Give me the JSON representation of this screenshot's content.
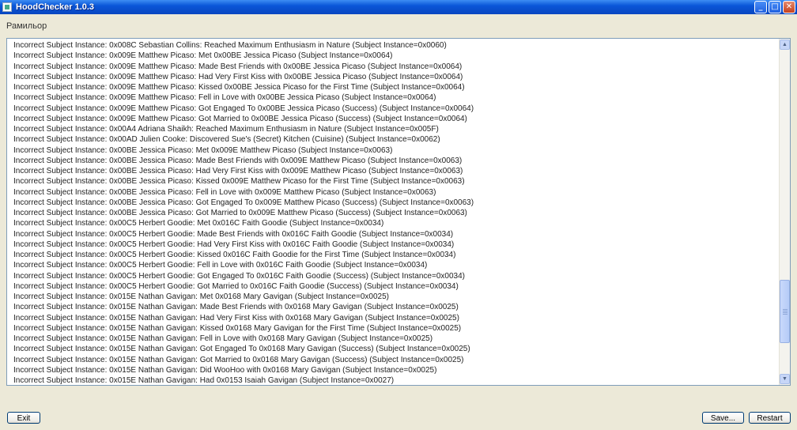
{
  "window": {
    "title": "HoodChecker 1.0.3",
    "minimize_glyph": "_",
    "maximize_glyph": "□",
    "close_glyph": "✕"
  },
  "group_label": "Рамильор",
  "log_lines": [
    "Incorrect Subject Instance: 0x008C Sebastian Collins: Reached Maximum Enthusiasm in Nature (Subject Instance=0x0060)",
    "Incorrect Subject Instance: 0x009E Matthew Picaso: Met 0x00BE Jessica Picaso (Subject Instance=0x0064)",
    "Incorrect Subject Instance: 0x009E Matthew Picaso: Made Best Friends with 0x00BE Jessica Picaso (Subject Instance=0x0064)",
    "Incorrect Subject Instance: 0x009E Matthew Picaso: Had Very First Kiss with 0x00BE Jessica Picaso (Subject Instance=0x0064)",
    "Incorrect Subject Instance: 0x009E Matthew Picaso: Kissed 0x00BE Jessica Picaso for the First Time (Subject Instance=0x0064)",
    "Incorrect Subject Instance: 0x009E Matthew Picaso: Fell in Love with 0x00BE Jessica Picaso (Subject Instance=0x0064)",
    "Incorrect Subject Instance: 0x009E Matthew Picaso: Got Engaged To 0x00BE Jessica Picaso (Success) (Subject Instance=0x0064)",
    "Incorrect Subject Instance: 0x009E Matthew Picaso: Got Married to 0x00BE Jessica Picaso (Success) (Subject Instance=0x0064)",
    "Incorrect Subject Instance: 0x00A4 Adriana Shaikh: Reached Maximum Enthusiasm in Nature (Subject Instance=0x005F)",
    "Incorrect Subject Instance: 0x00AD Julien Cooke: Discovered Sue's (Secret) Kitchen (Cuisine) (Subject Instance=0x0062)",
    "Incorrect Subject Instance: 0x00BE Jessica Picaso: Met 0x009E Matthew Picaso (Subject Instance=0x0063)",
    "Incorrect Subject Instance: 0x00BE Jessica Picaso: Made Best Friends with 0x009E Matthew Picaso (Subject Instance=0x0063)",
    "Incorrect Subject Instance: 0x00BE Jessica Picaso: Had Very First Kiss with 0x009E Matthew Picaso (Subject Instance=0x0063)",
    "Incorrect Subject Instance: 0x00BE Jessica Picaso: Kissed 0x009E Matthew Picaso for the First Time (Subject Instance=0x0063)",
    "Incorrect Subject Instance: 0x00BE Jessica Picaso: Fell in Love with 0x009E Matthew Picaso (Subject Instance=0x0063)",
    "Incorrect Subject Instance: 0x00BE Jessica Picaso: Got Engaged To 0x009E Matthew Picaso (Success) (Subject Instance=0x0063)",
    "Incorrect Subject Instance: 0x00BE Jessica Picaso: Got Married to 0x009E Matthew Picaso (Success) (Subject Instance=0x0063)",
    "Incorrect Subject Instance: 0x00C5 Herbert Goodie: Met 0x016C Faith Goodie (Subject Instance=0x0034)",
    "Incorrect Subject Instance: 0x00C5 Herbert Goodie: Made Best Friends with 0x016C Faith Goodie (Subject Instance=0x0034)",
    "Incorrect Subject Instance: 0x00C5 Herbert Goodie: Had Very First Kiss with 0x016C Faith Goodie (Subject Instance=0x0034)",
    "Incorrect Subject Instance: 0x00C5 Herbert Goodie: Kissed 0x016C Faith Goodie for the First Time (Subject Instance=0x0034)",
    "Incorrect Subject Instance: 0x00C5 Herbert Goodie: Fell in Love with 0x016C Faith Goodie (Subject Instance=0x0034)",
    "Incorrect Subject Instance: 0x00C5 Herbert Goodie: Got Engaged To 0x016C Faith Goodie (Success) (Subject Instance=0x0034)",
    "Incorrect Subject Instance: 0x00C5 Herbert Goodie: Got Married to 0x016C Faith Goodie (Success) (Subject Instance=0x0034)",
    "Incorrect Subject Instance: 0x015E Nathan Gavigan: Met 0x0168 Mary Gavigan (Subject Instance=0x0025)",
    "Incorrect Subject Instance: 0x015E Nathan Gavigan: Made Best Friends with 0x0168 Mary Gavigan (Subject Instance=0x0025)",
    "Incorrect Subject Instance: 0x015E Nathan Gavigan: Had Very First Kiss with 0x0168 Mary Gavigan (Subject Instance=0x0025)",
    "Incorrect Subject Instance: 0x015E Nathan Gavigan: Kissed 0x0168 Mary Gavigan for the First Time (Subject Instance=0x0025)",
    "Incorrect Subject Instance: 0x015E Nathan Gavigan: Fell in Love with 0x0168 Mary Gavigan (Subject Instance=0x0025)",
    "Incorrect Subject Instance: 0x015E Nathan Gavigan: Got Engaged To 0x0168 Mary Gavigan (Success) (Subject Instance=0x0025)",
    "Incorrect Subject Instance: 0x015E Nathan Gavigan: Got Married to 0x0168 Mary Gavigan (Success) (Subject Instance=0x0025)",
    "Incorrect Subject Instance: 0x015E Nathan Gavigan: Did WooHoo with 0x0168 Mary Gavigan (Subject Instance=0x0025)",
    "Incorrect Subject Instance: 0x015E Nathan Gavigan: Had 0x0153 Isaiah Gavigan (Subject Instance=0x0027)"
  ],
  "buttons": {
    "exit": "Exit",
    "save": "Save...",
    "restart": "Restart"
  }
}
